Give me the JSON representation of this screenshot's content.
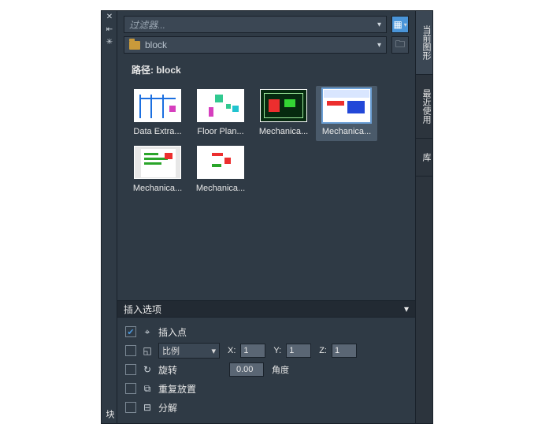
{
  "palette_title": "块",
  "filter": {
    "placeholder": "过滤器..."
  },
  "folder": {
    "name": "block"
  },
  "path_label": "路径: block",
  "side_tabs": [
    "当前图形",
    "最近使用",
    "库"
  ],
  "blocks": [
    {
      "label": "Data Extra..."
    },
    {
      "label": "Floor Plan..."
    },
    {
      "label": "Mechanica..."
    },
    {
      "label": "Mechanica..."
    },
    {
      "label": "Mechanica..."
    },
    {
      "label": "Mechanica..."
    }
  ],
  "options_header": "插入选项",
  "options": {
    "insertion_point": {
      "label": "插入点",
      "checked": true
    },
    "scale": {
      "label": "比例",
      "checked": false,
      "x_label": "X:",
      "x": "1",
      "y_label": "Y:",
      "y": "1",
      "z_label": "Z:",
      "z": "1"
    },
    "rotation": {
      "label": "旋转",
      "checked": false,
      "value": "0.00",
      "angle_label": "角度"
    },
    "repeat": {
      "label": "重复放置",
      "checked": false
    },
    "explode": {
      "label": "分解",
      "checked": false
    }
  },
  "icons": {
    "close": "✕",
    "pin": "⇤",
    "gear": "✳",
    "thumbs": "▦",
    "browse": "🗀",
    "caret": "▾"
  }
}
